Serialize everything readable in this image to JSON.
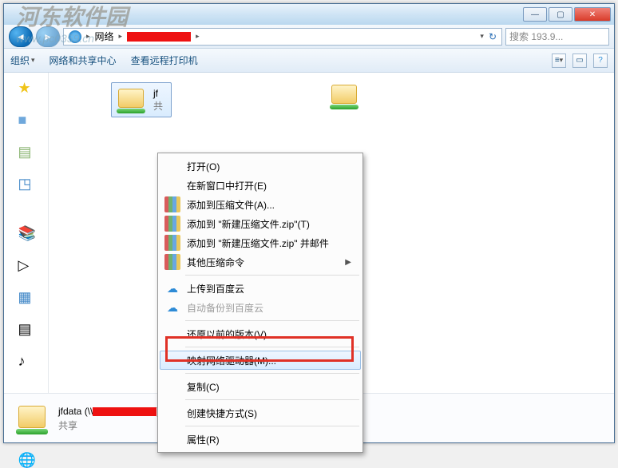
{
  "titlebar": {
    "min": "—",
    "max": "▢",
    "close": "✕"
  },
  "address": {
    "network": "网络",
    "search_placeholder": "搜索 193.9...",
    "refresh_icon": "↻",
    "dropdown_icon": "▾"
  },
  "toolbar": {
    "organize": "组织",
    "network_center": "网络和共享中心",
    "view_remote_printers": "查看远程打印机"
  },
  "items": {
    "selected_label": "jf",
    "selected_sub": "共"
  },
  "context_menu": {
    "open": "打开(O)",
    "open_new": "在新窗口中打开(E)",
    "add_to_archive": "添加到压缩文件(A)...",
    "add_to_zip": "添加到 \"新建压缩文件.zip\"(T)",
    "add_to_zip_mail": "添加到 \"新建压缩文件.zip\" 并邮件",
    "other_compress": "其他压缩命令",
    "upload_baidu": "上传到百度云",
    "auto_backup_baidu": "自动备份到百度云",
    "restore_prev": "还原以前的版本(V)",
    "map_drive": "映射网络驱动器(M)...",
    "copy": "复制(C)",
    "create_shortcut": "创建快捷方式(S)",
    "properties": "属性(R)"
  },
  "details": {
    "name_prefix": "jfdata (\\\\",
    "name_suffix": ")",
    "sub": "共享"
  },
  "watermark": {
    "cn": "河东软件园",
    "url": "www.pc0359.cn"
  }
}
